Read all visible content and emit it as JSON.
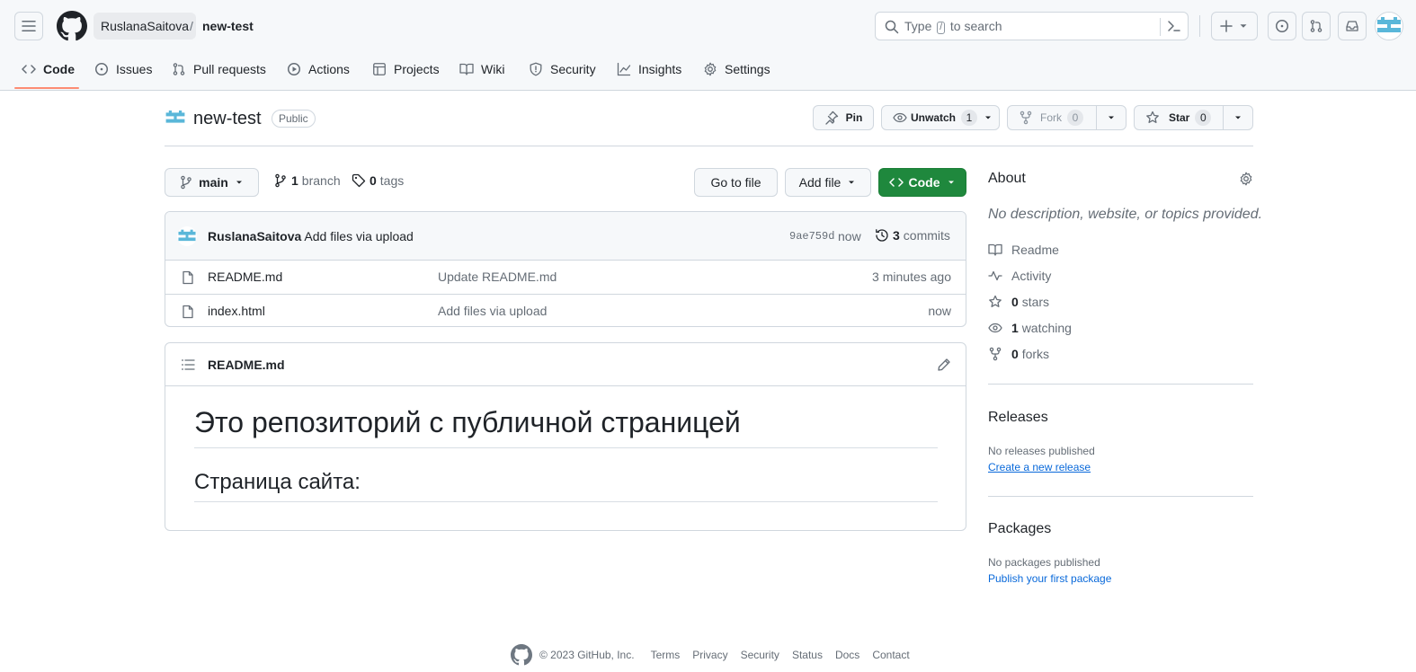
{
  "header": {
    "owner": "RuslanaSaitova",
    "separator": "/",
    "repo": "new-test",
    "search_prefix": "Type",
    "search_key": "/",
    "search_suffix": "to search"
  },
  "repo_nav": {
    "items": [
      {
        "label": "Code",
        "icon": "code-icon",
        "active": true
      },
      {
        "label": "Issues",
        "icon": "issue-icon"
      },
      {
        "label": "Pull requests",
        "icon": "pull-request-icon"
      },
      {
        "label": "Actions",
        "icon": "play-icon"
      },
      {
        "label": "Projects",
        "icon": "table-icon"
      },
      {
        "label": "Wiki",
        "icon": "book-icon"
      },
      {
        "label": "Security",
        "icon": "shield-icon"
      },
      {
        "label": "Insights",
        "icon": "graph-icon"
      },
      {
        "label": "Settings",
        "icon": "gear-icon"
      }
    ]
  },
  "repo_title": {
    "name": "new-test",
    "visibility": "Public",
    "pin_label": "Pin",
    "unwatch_label": "Unwatch",
    "watch_count": "1",
    "fork_label": "Fork",
    "fork_count": "0",
    "star_label": "Star",
    "star_count": "0"
  },
  "branch_bar": {
    "branch": "main",
    "branch_count": "1",
    "branch_word": "branch",
    "tag_count": "0",
    "tag_word": "tags",
    "go_to_file": "Go to file",
    "add_file": "Add file",
    "code": "Code"
  },
  "commit": {
    "author": "RuslanaSaitova",
    "message": "Add files via upload",
    "sha": "9ae759d",
    "time": "now",
    "commit_count": "3",
    "commit_word": "commits"
  },
  "files": [
    {
      "name": "README.md",
      "message": "Update README.md",
      "time": "3 minutes ago"
    },
    {
      "name": "index.html",
      "message": "Add files via upload",
      "time": "now"
    }
  ],
  "readme": {
    "filename": "README.md",
    "h1": "Это репозиторий с публичной страницей",
    "h2": "Страница сайта:"
  },
  "about": {
    "title": "About",
    "description": "No description, website, or topics provided.",
    "readme": "Readme",
    "activity": "Activity",
    "stars_count": "0",
    "stars_word": "stars",
    "watching_count": "1",
    "watching_word": "watching",
    "forks_count": "0",
    "forks_word": "forks"
  },
  "releases": {
    "title": "Releases",
    "empty": "No releases published",
    "link": "Create a new release"
  },
  "packages": {
    "title": "Packages",
    "empty": "No packages published",
    "link": "Publish your first package"
  },
  "footer": {
    "copyright": "© 2023 GitHub, Inc.",
    "links": [
      "Terms",
      "Privacy",
      "Security",
      "Status",
      "Docs",
      "Contact"
    ]
  },
  "colors": {
    "accent_green": "#1f883d",
    "link_blue": "#0969da",
    "nav_underline": "#fd8c73",
    "border": "#d0d7de",
    "muted": "#656d76"
  }
}
